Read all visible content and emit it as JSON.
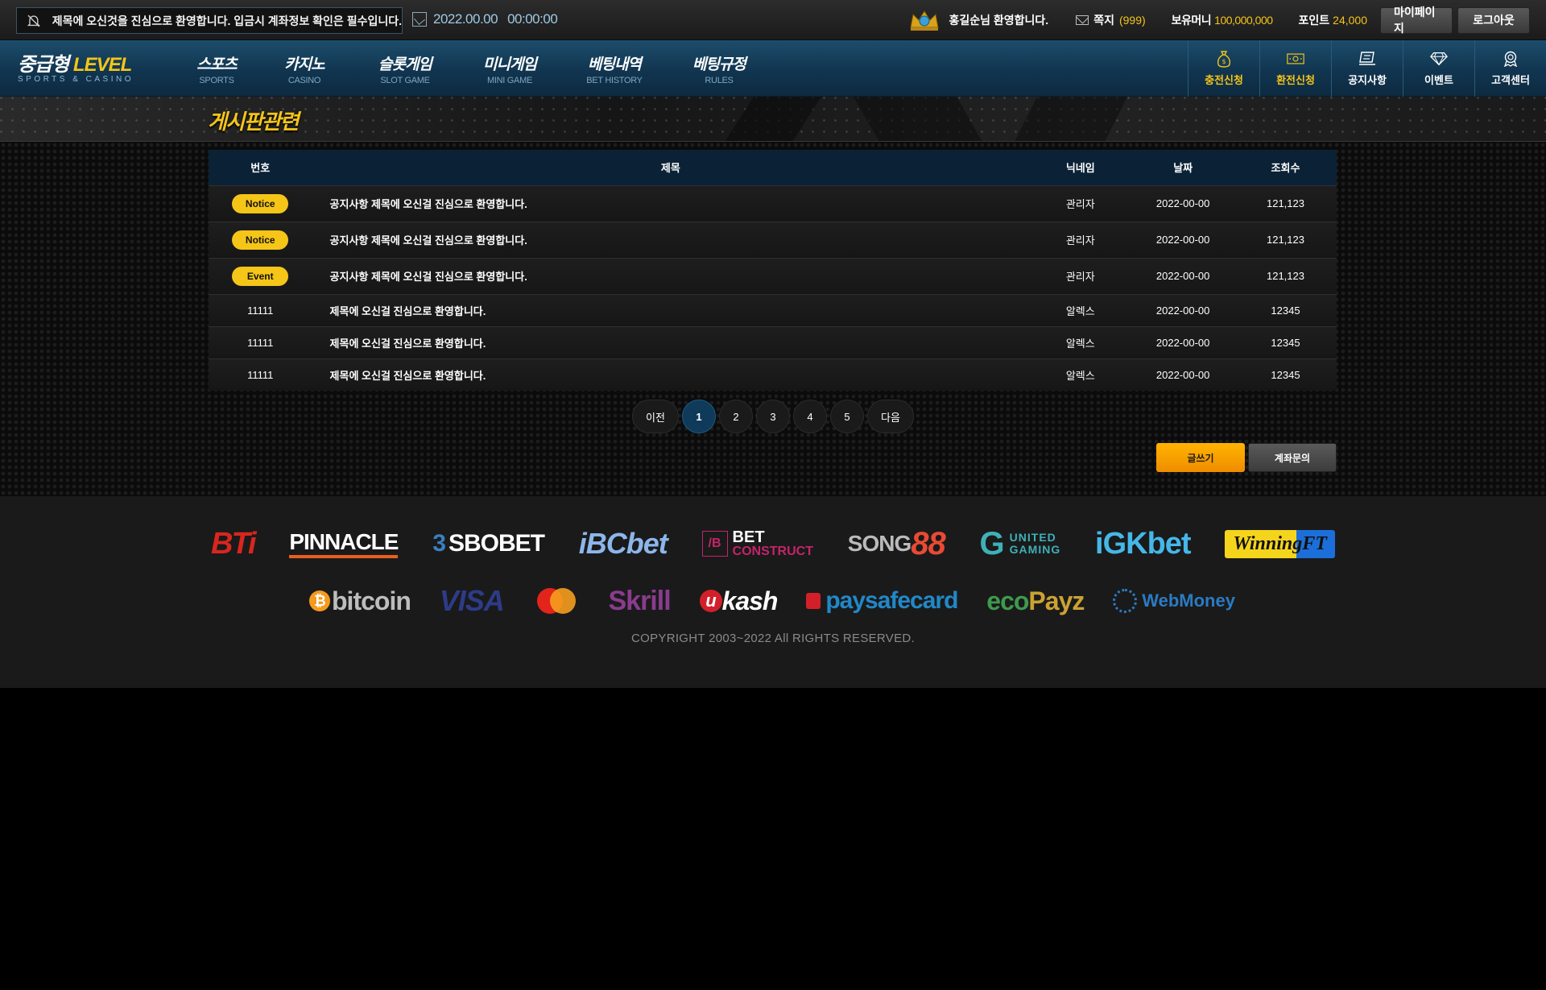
{
  "topbar": {
    "notice": "제목에 오신것을 진심으로 환영합니다. 입금시 계좌정보 확인은 필수입니다.",
    "date": "2022.00.00",
    "time": "00:00:00",
    "welcome": "홍길순님 환영합니다.",
    "message_label": "쪽지",
    "message_count": "(999)",
    "money_label": "보유머니",
    "money_value": "100,000,000",
    "point_label": "포인트",
    "point_value": "24,000",
    "mypage": "마이페이지",
    "logout": "로그아웃"
  },
  "logo": {
    "main_white": "중급형",
    "main_yellow": "LEVEL",
    "sub": "SPORTS & CASINO"
  },
  "nav": {
    "items": [
      {
        "ko": "스포츠",
        "en": "SPORTS"
      },
      {
        "ko": "카지노",
        "en": "CASINO"
      },
      {
        "ko": "슬롯게임",
        "en": "SLOT GAME"
      },
      {
        "ko": "미니게임",
        "en": "MINI GAME"
      },
      {
        "ko": "베팅내역",
        "en": "BET HISTORY"
      },
      {
        "ko": "베팅규정",
        "en": "RULES"
      }
    ],
    "quick": [
      {
        "label": "충전신청",
        "icon": "money-bag-icon"
      },
      {
        "label": "환전신청",
        "icon": "banknote-icon"
      },
      {
        "label": "공지사항",
        "icon": "notice-board-icon"
      },
      {
        "label": "이벤트",
        "icon": "diamond-icon"
      },
      {
        "label": "고객센터",
        "icon": "support-badge-icon"
      }
    ]
  },
  "section": {
    "title": "게시판관련"
  },
  "table": {
    "headers": {
      "no": "번호",
      "subject": "제목",
      "nickname": "닉네임",
      "date": "날짜",
      "views": "조회수"
    },
    "rows": [
      {
        "no": "Notice",
        "subject": "공지사항 제목에 오신걸 진심으로 환영합니다.",
        "nickname": "관리자",
        "date": "2022-00-00",
        "views": "121,123"
      },
      {
        "no": "Notice",
        "subject": "공지사항 제목에 오신걸 진심으로 환영합니다.",
        "nickname": "관리자",
        "date": "2022-00-00",
        "views": "121,123"
      },
      {
        "no": "Event",
        "subject": "공지사항 제목에 오신걸 진심으로 환영합니다.",
        "nickname": "관리자",
        "date": "2022-00-00",
        "views": "121,123"
      },
      {
        "no": "11111",
        "subject": "제목에 오신걸 진심으로 환영합니다.",
        "nickname": "알렉스",
        "date": "2022-00-00",
        "views": "12345"
      },
      {
        "no": "11111",
        "subject": "제목에 오신걸 진심으로 환영합니다.",
        "nickname": "알렉스",
        "date": "2022-00-00",
        "views": "12345"
      },
      {
        "no": "11111",
        "subject": "제목에 오신걸 진심으로 환영합니다.",
        "nickname": "알렉스",
        "date": "2022-00-00",
        "views": "12345"
      }
    ]
  },
  "pagination": {
    "prev": "이전",
    "pages": [
      "1",
      "2",
      "3",
      "4",
      "5"
    ],
    "next": "다음",
    "current": "1"
  },
  "actions": {
    "write": "글쓰기",
    "account_inquiry": "계좌문의"
  },
  "footer": {
    "providers": [
      "BTi SPORTS",
      "PINNACLE",
      "SBOBET",
      "iBCbet",
      "BETCONSTRUCT",
      "SONG88",
      "UNITED GAMING",
      "iGKbet",
      "WinningFT"
    ],
    "payments": [
      "bitcoin",
      "VISA",
      "mastercard",
      "Skrill",
      "ukash",
      "paysafecard",
      "ecoPayz",
      "WebMoney"
    ],
    "copyright": "COPYRIGHT 2003~2022 All RIGHTS RESERVED."
  },
  "colors": {
    "accent": "#f5c518",
    "nav_blue": "#113550",
    "table_header": "#0b2236",
    "page_active": "#0f3a59"
  }
}
